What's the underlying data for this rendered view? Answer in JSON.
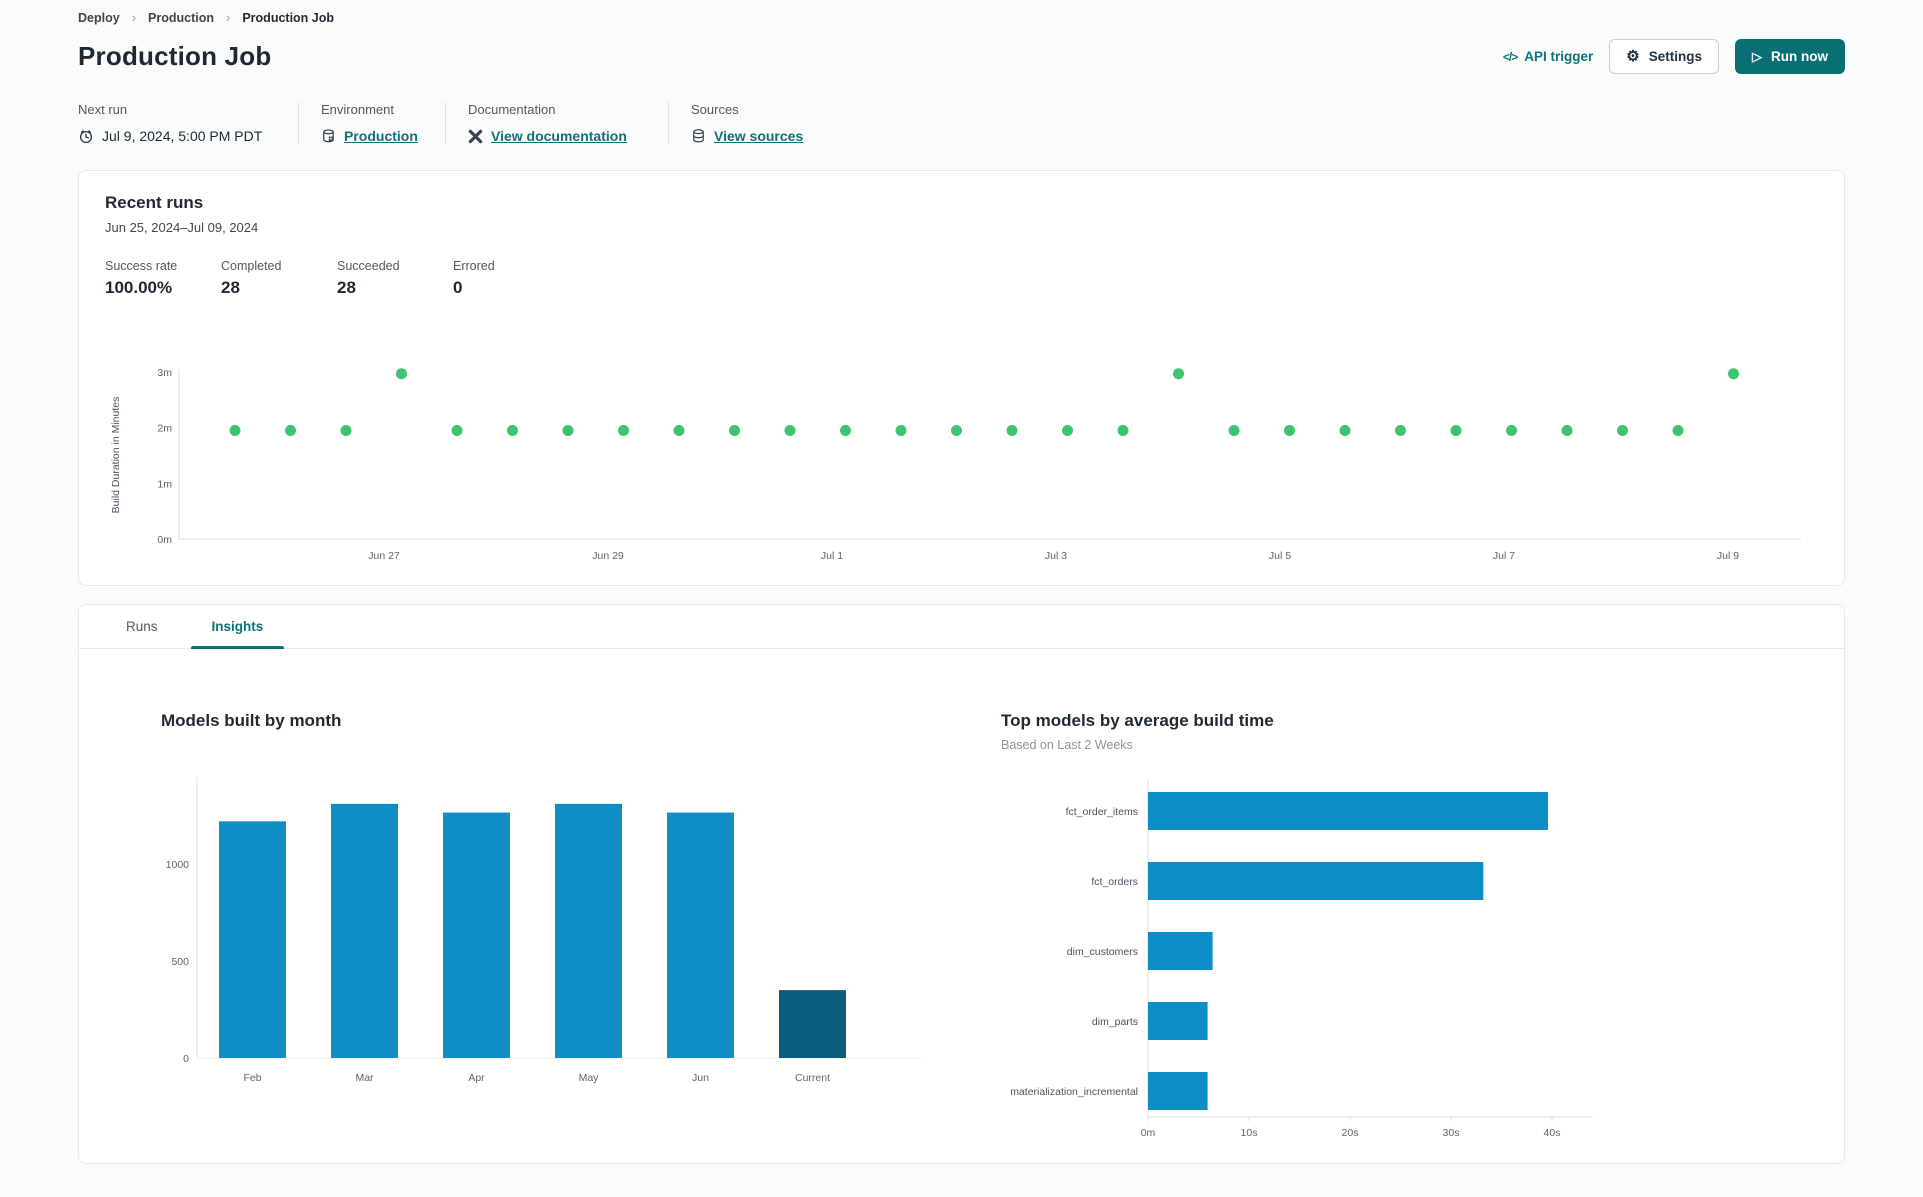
{
  "breadcrumb": {
    "items": [
      "Deploy",
      "Production",
      "Production Job"
    ]
  },
  "header": {
    "title": "Production Job",
    "api_trigger_label": "API trigger",
    "settings_label": "Settings",
    "run_now_label": "Run now"
  },
  "meta": {
    "next_run": {
      "label": "Next run",
      "value": "Jul 9, 2024, 5:00 PM PDT",
      "icon": "alarm-clock-icon"
    },
    "environment": {
      "label": "Environment",
      "value": "Production",
      "icon": "environment-database-icon"
    },
    "documentation": {
      "label": "Documentation",
      "value": "View documentation",
      "icon": "dbt-docs-icon"
    },
    "sources": {
      "label": "Sources",
      "value": "View sources",
      "icon": "database-icon"
    }
  },
  "recent_runs": {
    "title": "Recent runs",
    "date_range": "Jun 25, 2024–Jul 09, 2024",
    "stats": [
      {
        "label": "Success rate",
        "value": "100.00%"
      },
      {
        "label": "Completed",
        "value": "28"
      },
      {
        "label": "Succeeded",
        "value": "28"
      },
      {
        "label": "Errored",
        "value": "0"
      }
    ]
  },
  "tabs": [
    {
      "label": "Runs",
      "active": false
    },
    {
      "label": "Insights",
      "active": true
    }
  ],
  "colors": {
    "accent_teal": "#0b7378",
    "run_button": "#0a6f74",
    "dot_green": "#3ec46f",
    "bar_blue": "#0e8dc6",
    "bar_dark_blue": "#0b5d7e",
    "axis_gray": "#dadfe3"
  },
  "chart_data": [
    {
      "name": "build_duration_scatter",
      "type": "scatter",
      "ylabel": "Build Duration in Minutes",
      "y_ticks": [
        "0m",
        "1m",
        "2m",
        "3m"
      ],
      "y_tick_values": [
        0,
        1,
        2,
        3
      ],
      "ylim": [
        0,
        3.1
      ],
      "x_ticks": [
        "Jun 27",
        "Jun 29",
        "Jul 1",
        "Jul 3",
        "Jul 5",
        "Jul 7",
        "Jul 9"
      ],
      "points_minutes": [
        1.95,
        1.95,
        1.95,
        2.97,
        1.95,
        1.95,
        1.95,
        1.95,
        1.95,
        1.95,
        1.95,
        1.95,
        1.95,
        1.95,
        1.95,
        1.95,
        1.95,
        2.97,
        1.95,
        1.95,
        1.95,
        1.95,
        1.95,
        1.95,
        1.95,
        1.95,
        1.95,
        2.97
      ],
      "point_color": "#3ec46f"
    },
    {
      "name": "models_built_by_month",
      "type": "bar",
      "title": "Models built by month",
      "categories": [
        "Feb",
        "Mar",
        "Apr",
        "May",
        "Jun",
        "Current"
      ],
      "values": [
        1220,
        1310,
        1265,
        1310,
        1265,
        350
      ],
      "y_ticks": [
        "0",
        "500",
        "1000"
      ],
      "y_tick_values": [
        0,
        500,
        1000
      ],
      "ylim": [
        0,
        1420
      ],
      "bar_colors": [
        "#0e8dc6",
        "#0e8dc6",
        "#0e8dc6",
        "#0e8dc6",
        "#0e8dc6",
        "#0b5d7e"
      ]
    },
    {
      "name": "top_models_by_average_build_time",
      "type": "bar-horizontal",
      "title": "Top models by average build time",
      "subtitle": "Based on Last 2 Weeks",
      "categories": [
        "fct_order_items",
        "fct_orders",
        "dim_customers",
        "dim_parts",
        "materialization_incremental"
      ],
      "values_seconds": [
        39.6,
        33.2,
        6.4,
        5.9,
        5.9
      ],
      "x_ticks": [
        "0m",
        "10s",
        "20s",
        "30s",
        "40s"
      ],
      "x_tick_values": [
        0,
        10,
        20,
        30,
        40
      ],
      "xlim": [
        0,
        45
      ],
      "bar_color": "#0e8dc6"
    }
  ]
}
